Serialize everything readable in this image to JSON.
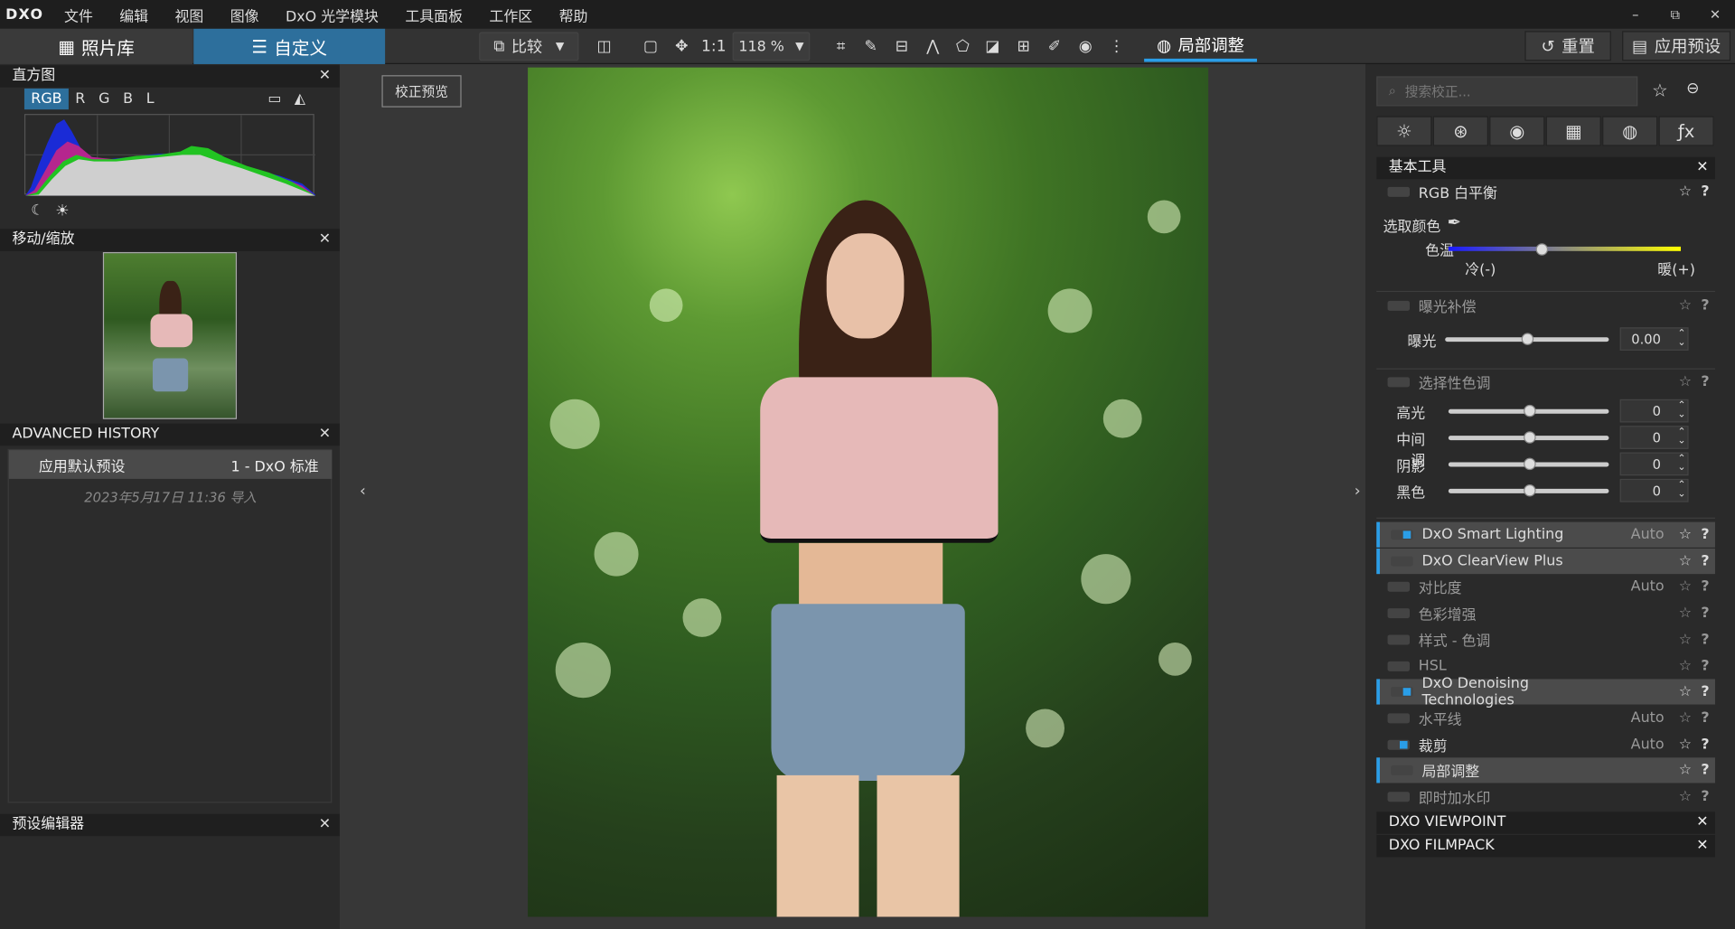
{
  "menubar": {
    "logo": "DXO",
    "items": [
      "文件",
      "编辑",
      "视图",
      "图像",
      "DxO 光学模块",
      "工具面板",
      "工作区",
      "帮助"
    ],
    "win": [
      "–",
      "⧉",
      "✕"
    ]
  },
  "toolbar": {
    "library": "照片库",
    "custom": "自定义",
    "compare": "比较",
    "ratio": "1:1",
    "zoom": "118 %",
    "local": "局部调整",
    "reset": "重置",
    "apply": "应用预设"
  },
  "left": {
    "histogram": {
      "title": "直方图",
      "tabs": [
        "RGB",
        "R",
        "G",
        "B",
        "L"
      ]
    },
    "movezoom": {
      "title": "移动/缩放"
    },
    "history": {
      "title": "ADVANCED HISTORY",
      "row_label": "应用默认预设",
      "row_value": "1 - DxO 标准",
      "date": "2023年5月17日 11:36 导入"
    },
    "preset": {
      "title": "预设编辑器"
    }
  },
  "center": {
    "preview_button": "校正预览"
  },
  "right": {
    "search_placeholder": "搜索校正...",
    "basic": {
      "title": "基本工具"
    },
    "wb": {
      "name": "RGB 白平衡",
      "pick": "选取颜色",
      "temp": "色温",
      "cold": "冷(-)",
      "warm": "暖(+)",
      "temp_value": 0.4
    },
    "exposure": {
      "name": "曝光补偿",
      "label": "曝光",
      "value": "0.00",
      "level": 0.5
    },
    "selective": {
      "name": "选择性色调",
      "rows": [
        {
          "label": "高光",
          "value": "0"
        },
        {
          "label": "中间调",
          "value": "0"
        },
        {
          "label": "阴影",
          "value": "0"
        },
        {
          "label": "黑色",
          "value": "0"
        }
      ]
    },
    "tools": [
      {
        "name": "DxO Smart Lighting",
        "auto": "Auto",
        "on": true,
        "hl": true
      },
      {
        "name": "DxO ClearView Plus",
        "auto": "",
        "on": false,
        "hl": true
      },
      {
        "name": "对比度",
        "auto": "Auto",
        "on": false,
        "hl": false
      },
      {
        "name": "色彩增强",
        "auto": "",
        "on": false,
        "hl": false
      },
      {
        "name": "样式 - 色调",
        "auto": "",
        "on": false,
        "hl": false
      },
      {
        "name": "HSL",
        "auto": "",
        "on": false,
        "hl": false
      },
      {
        "name": "DxO Denoising Technologies",
        "auto": "",
        "on": true,
        "hl": true
      },
      {
        "name": "水平线",
        "auto": "Auto",
        "on": false,
        "hl": false
      },
      {
        "name": "裁剪",
        "auto": "Auto",
        "on": true,
        "hl": false
      },
      {
        "name": "局部调整",
        "auto": "",
        "on": false,
        "hl": true
      },
      {
        "name": "即时加水印",
        "auto": "",
        "on": false,
        "hl": false
      }
    ],
    "viewpoint": "DXO VIEWPOINT",
    "filmpack": "DXO FILMPACK"
  }
}
